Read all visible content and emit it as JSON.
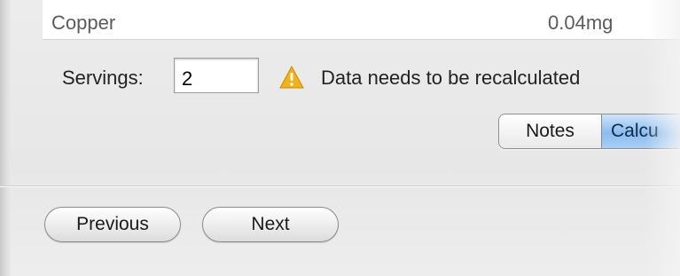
{
  "nutrient_row": {
    "name": "Copper",
    "value": "0.04mg"
  },
  "servings": {
    "label": "Servings:",
    "value": "2"
  },
  "warning": {
    "icon": "warning-icon",
    "text": "Data needs to be recalculated",
    "color": "#f2b21b"
  },
  "view_toggle": {
    "notes_label": "Notes",
    "calc_label": "Calcu",
    "selected": "Calcu"
  },
  "navigation": {
    "previous_label": "Previous",
    "next_label": "Next"
  }
}
